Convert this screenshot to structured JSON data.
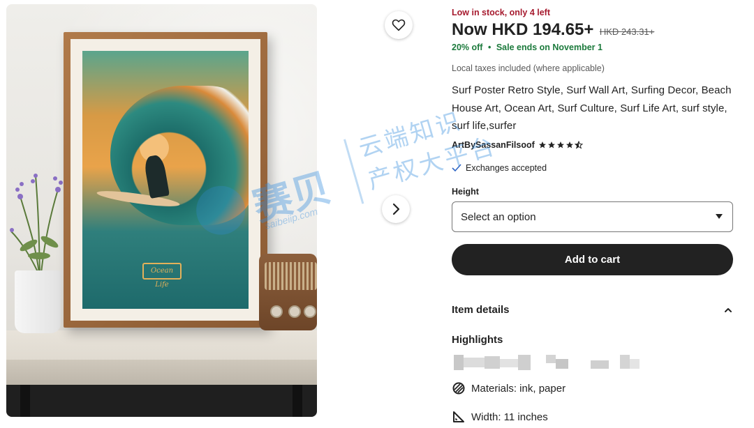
{
  "product": {
    "stock_notice": "Low in stock, only 4 left",
    "price_now": "Now HKD 194.65+",
    "price_original": "HKD 243.31+",
    "discount": "20% off",
    "sale_separator": "•",
    "sale_ends": "Sale ends on November 1",
    "taxes_note": "Local taxes included (where applicable)",
    "title": "Surf Poster Retro Style, Surf Wall Art, Surfing Decor, Beach House Art, Ocean Art, Surf Culture, Surf Life Art, surf style, surf life,surfer",
    "seller": "ArtBySassanFilsoof",
    "rating": 4.5,
    "rating_max": 5,
    "exchanges": "Exchanges accepted"
  },
  "variation": {
    "label": "Height",
    "placeholder": "Select an option"
  },
  "actions": {
    "add_to_cart": "Add to cart"
  },
  "details": {
    "section_title": "Item details",
    "highlights_title": "Highlights",
    "materials": "Materials: ink, paper",
    "width": "Width: 11 inches"
  },
  "artwork": {
    "badge_text": "Ocean Life"
  },
  "watermark": {
    "brand": "赛贝",
    "site": "saibeiip.com",
    "line1": "云端知识",
    "line2": "产权大平台"
  },
  "icons": {
    "favorite": "heart-icon",
    "next": "chevron-right-icon",
    "check": "check-icon",
    "dropdown": "caret-down-icon",
    "collapse": "chevron-up-icon",
    "materials": "materials-icon",
    "width": "ruler-icon"
  },
  "colors": {
    "stock_red": "#a61a2e",
    "sale_green": "#1c7a3c",
    "button_dark": "#222222"
  }
}
